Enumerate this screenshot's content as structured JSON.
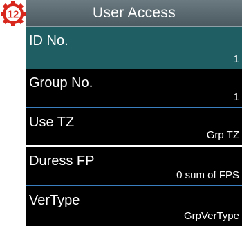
{
  "step_badge": {
    "number": "12",
    "color": "#d8281e"
  },
  "header": {
    "title": "User Access"
  },
  "menu": [
    {
      "label": "ID No.",
      "value": "1",
      "selected": true
    },
    {
      "label": "Group No.",
      "value": "1",
      "selected": false
    },
    {
      "label": "Use TZ",
      "value": "Grp TZ",
      "selected": false
    },
    {
      "label": "Duress FP",
      "value": "0 sum of FPS",
      "selected": false
    },
    {
      "label": "VerType",
      "value": "GrpVerType",
      "selected": false
    }
  ],
  "colors": {
    "selected_row": "#1f5e63",
    "separator": "#3a7fbf",
    "background": "#000000"
  }
}
